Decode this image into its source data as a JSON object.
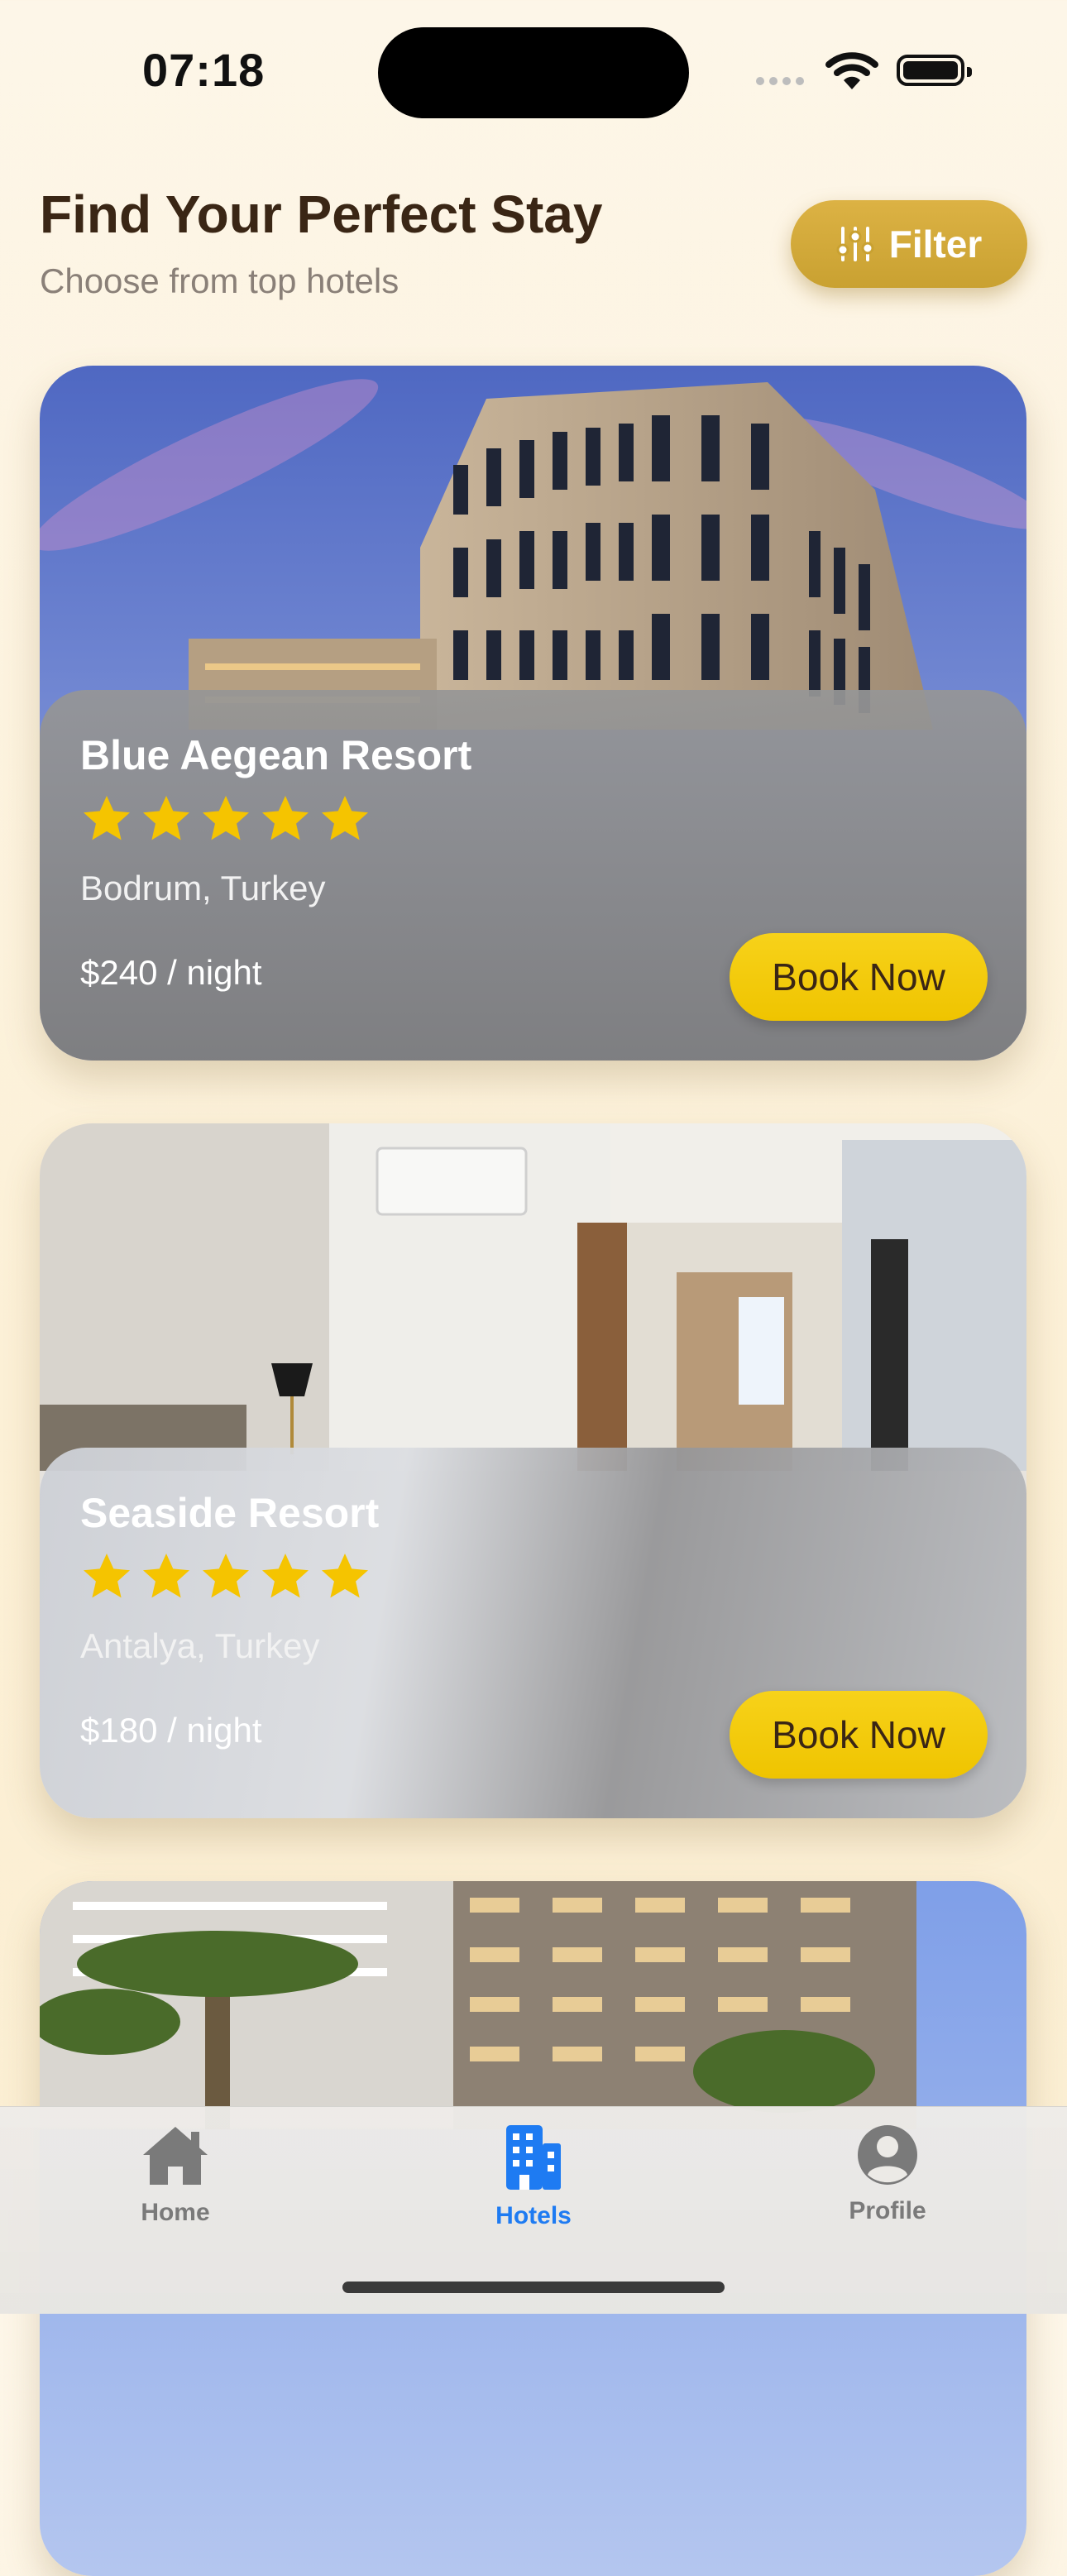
{
  "status_bar": {
    "time": "07:18"
  },
  "header": {
    "title": "Find Your Perfect Stay",
    "subtitle": "Choose from top hotels",
    "filter_label": "Filter"
  },
  "hotels": [
    {
      "name": "Blue Aegean Resort",
      "rating": 5,
      "location": "Bodrum, Turkey",
      "price": "$240 / night",
      "book_label": "Book Now"
    },
    {
      "name": "Seaside Resort",
      "rating": 5,
      "location": "Antalya, Turkey",
      "price": "$180 / night",
      "book_label": "Book Now"
    }
  ],
  "tab_bar": {
    "tabs": [
      {
        "label": "Home",
        "icon": "house-icon",
        "active": false
      },
      {
        "label": "Hotels",
        "icon": "building-icon",
        "active": true
      },
      {
        "label": "Profile",
        "icon": "person-circle-icon",
        "active": false
      }
    ]
  },
  "colors": {
    "accent_gold": "#C9A131",
    "book_yellow": "#F2C700",
    "active_tab": "#1E7BF2",
    "inactive_tab": "#7A7A7A",
    "star": "#F5C400"
  }
}
